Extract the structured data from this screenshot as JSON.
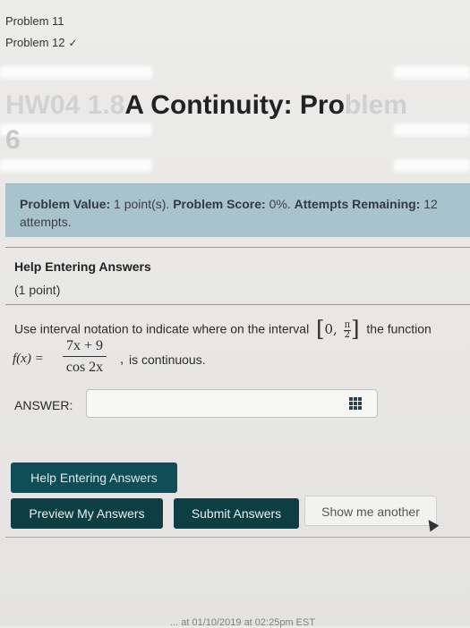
{
  "problem_list": [
    {
      "label": "Problem 11",
      "completed": false
    },
    {
      "label": "Problem 12",
      "completed": true,
      "check": "✓"
    }
  ],
  "title": {
    "faded_prefix": "HW04 1.8",
    "main": "A Continuity: Pro",
    "faded_suffix": "blem",
    "line2": "6"
  },
  "info": {
    "value_label": "Problem Value:",
    "value_text": "1 point(s).",
    "score_label": "Problem Score:",
    "score_text": "0%.",
    "attempts_label": "Attempts Remaining:",
    "attempts_text": "12 attempts."
  },
  "help": {
    "heading": "Help Entering Answers",
    "points": "(1 point)"
  },
  "question": {
    "intro": "Use interval notation to indicate where on the interval",
    "interval_start": "0,",
    "pi": "π",
    "two": "2",
    "after_interval": "the function",
    "fx": "f(x) =",
    "numerator": "7x + 9",
    "denominator": "cos 2x",
    "comma": ",",
    "continuous": "is continuous."
  },
  "answer": {
    "label": "ANSWER:",
    "value": "",
    "placeholder": ""
  },
  "buttons": {
    "help": "Help Entering Answers",
    "preview": "Preview My Answers",
    "submit": "Submit Answers",
    "show_another": "Show me another"
  },
  "footer": "... at 01/10/2019 at 02:25pm EST",
  "colors": {
    "info_box": "#a9c3cd",
    "button_dark": "#0d3e43",
    "button_help": "#0f4d57"
  }
}
